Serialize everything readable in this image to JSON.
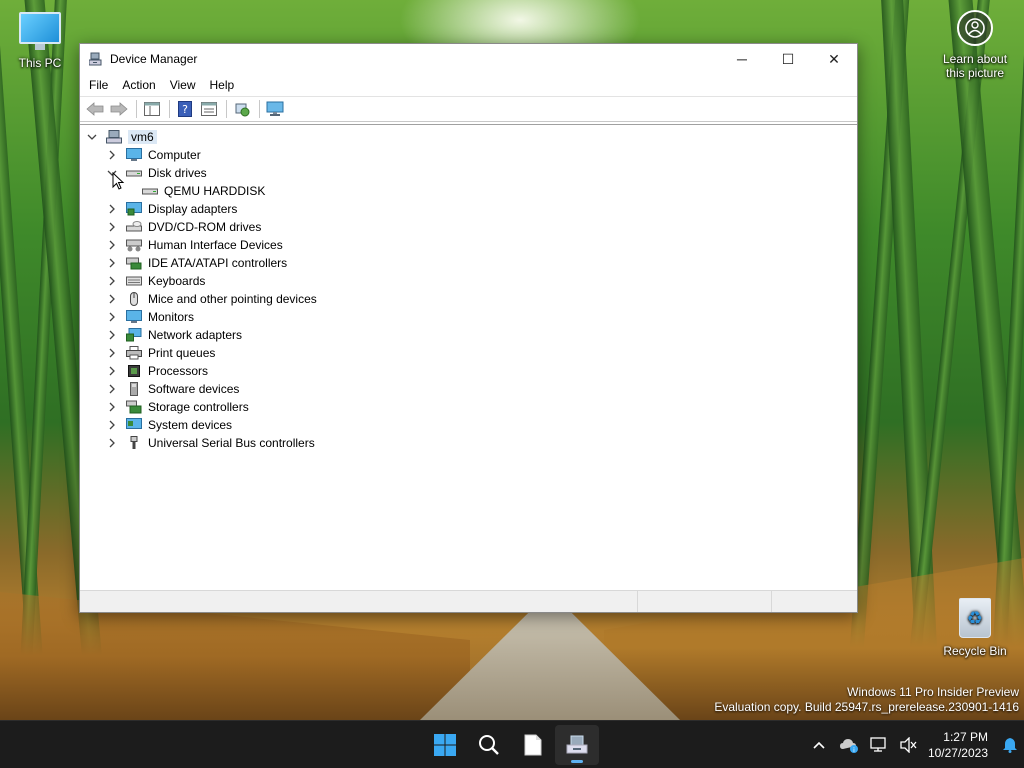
{
  "desktop": {
    "this_pc": "This PC",
    "learn_line1": "Learn about",
    "learn_line2": "this picture",
    "recycle_bin": "Recycle Bin",
    "watermark_line1": "Windows 11 Pro Insider Preview",
    "watermark_line2": "Evaluation copy. Build 25947.rs_prerelease.230901-1416"
  },
  "window": {
    "title": "Device Manager",
    "minimize": "─",
    "maximize": "☐",
    "close": "✕"
  },
  "menu": [
    "File",
    "Action",
    "View",
    "Help"
  ],
  "tree": {
    "root": "vm6",
    "categories": [
      {
        "label": "Computer",
        "icon": "computer-icon",
        "expanded": false
      },
      {
        "label": "Disk drives",
        "icon": "disk-drive-icon",
        "expanded": true,
        "children": [
          "QEMU HARDDISK"
        ]
      },
      {
        "label": "Display adapters",
        "icon": "display-adapter-icon",
        "expanded": false
      },
      {
        "label": "DVD/CD-ROM drives",
        "icon": "dvd-drive-icon",
        "expanded": false
      },
      {
        "label": "Human Interface Devices",
        "icon": "hid-icon",
        "expanded": false
      },
      {
        "label": "IDE ATA/ATAPI controllers",
        "icon": "ide-controller-icon",
        "expanded": false
      },
      {
        "label": "Keyboards",
        "icon": "keyboard-icon",
        "expanded": false
      },
      {
        "label": "Mice and other pointing devices",
        "icon": "mouse-icon",
        "expanded": false
      },
      {
        "label": "Monitors",
        "icon": "monitor-icon",
        "expanded": false
      },
      {
        "label": "Network adapters",
        "icon": "network-adapter-icon",
        "expanded": false
      },
      {
        "label": "Print queues",
        "icon": "printer-icon",
        "expanded": false
      },
      {
        "label": "Processors",
        "icon": "processor-icon",
        "expanded": false
      },
      {
        "label": "Software devices",
        "icon": "software-device-icon",
        "expanded": false
      },
      {
        "label": "Storage controllers",
        "icon": "storage-controller-icon",
        "expanded": false
      },
      {
        "label": "System devices",
        "icon": "system-device-icon",
        "expanded": false
      },
      {
        "label": "Universal Serial Bus controllers",
        "icon": "usb-icon",
        "expanded": false
      }
    ]
  },
  "taskbar": {
    "time": "1:27 PM",
    "date": "10/27/2023"
  },
  "colors": {
    "taskbar_bg": "#1c1c1c",
    "selection_bg": "#dbe8f5",
    "accent": "#5fb2f2"
  }
}
